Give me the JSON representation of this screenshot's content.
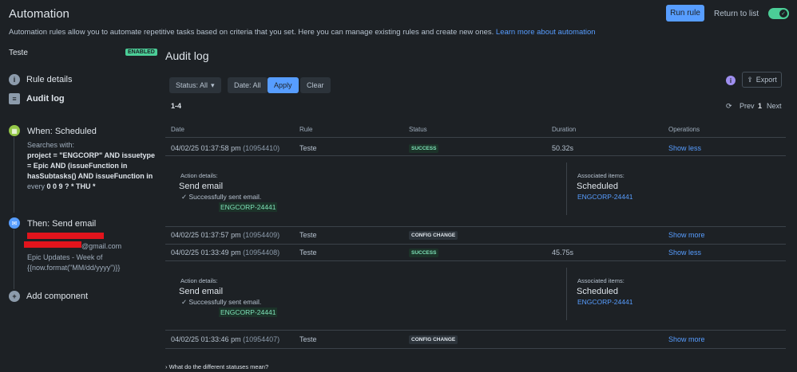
{
  "header": {
    "title": "Automation",
    "description": "Automation rules allow you to automate repetitive tasks based on criteria that you set. Here you can manage existing rules and create new ones.",
    "learn_more": "Learn more about automation",
    "run_rule": "Run rule",
    "return_to_list": "Return to list",
    "enabled_toggle": true
  },
  "sidebar": {
    "rule_name": "Teste",
    "status_badge": "ENABLED",
    "nav": [
      {
        "label": "Rule details",
        "icon": "info-icon"
      },
      {
        "label": "Audit log",
        "icon": "list-icon"
      }
    ],
    "trigger": {
      "title": "When: Scheduled",
      "line1": "Searches with:",
      "jql": "project = \"ENGCORP\" AND issuetype = Epic AND (issueFunction in hasSubtasks() AND issueFunction in",
      "every_prefix": "every",
      "cron": "0 0 9 ? * THU *"
    },
    "action": {
      "title": "Then: Send email",
      "email_suffix": "@gmail.com",
      "subject": "Epic Updates - Week of",
      "subject2": "{{now.format(\"MM/dd/yyyy\")}}"
    },
    "add_component": "Add component"
  },
  "audit": {
    "title": "Audit log",
    "filters": {
      "status": "Status: All",
      "date": "Date: All",
      "apply": "Apply",
      "clear": "Clear"
    },
    "export": "Export",
    "range": "1-4",
    "pager": {
      "prev": "Prev",
      "page": "1",
      "next": "Next"
    },
    "columns": [
      "Date",
      "Rule",
      "Status",
      "Duration",
      "Operations"
    ],
    "rows": [
      {
        "date": "04/02/25 01:37:58 pm",
        "id": "(10954410)",
        "rule": "Teste",
        "status": "SUCCESS",
        "duration": "50.32s",
        "op": "Show less"
      },
      {
        "date": "04/02/25 01:37:57 pm",
        "id": "(10954409)",
        "rule": "Teste",
        "status": "CONFIG CHANGE",
        "duration": "",
        "op": "Show more"
      },
      {
        "date": "04/02/25 01:33:49 pm",
        "id": "(10954408)",
        "rule": "Teste",
        "status": "SUCCESS",
        "duration": "45.75s",
        "op": "Show less"
      },
      {
        "date": "04/02/25 01:33:46 pm",
        "id": "(10954407)",
        "rule": "Teste",
        "status": "CONFIG CHANGE",
        "duration": "",
        "op": "Show more"
      }
    ],
    "details": [
      {
        "action_label": "Action details:",
        "action": "Send email",
        "result": "Successfully sent email.",
        "issue": "ENGCORP-24441",
        "assoc_label": "Associated items:",
        "assoc": "Scheduled",
        "assoc_issue": "ENGCORP-24441"
      },
      {
        "action_label": "Action details:",
        "action": "Send email",
        "result": "Successfully sent email.",
        "issue": "ENGCORP-24441",
        "assoc_label": "Associated items:",
        "assoc": "Scheduled",
        "assoc_issue": "ENGCORP-24441"
      }
    ],
    "status_help": "What do the different statuses mean?"
  }
}
